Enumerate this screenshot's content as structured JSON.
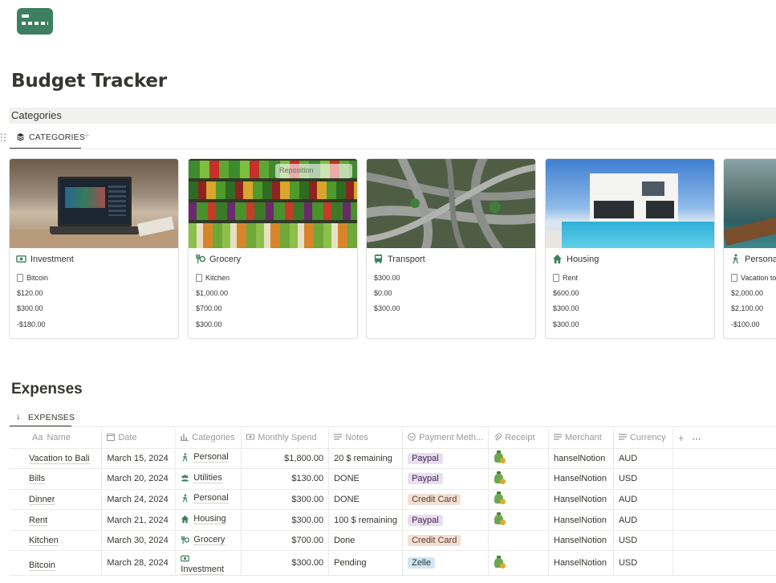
{
  "page": {
    "title": "Budget Tracker"
  },
  "categories": {
    "section_label": "Categories",
    "tab_label": "CATEGORIES",
    "cards": [
      {
        "name": "Investment",
        "cover": "laptop-stock-chart",
        "icon": "money-icon",
        "expense": "Bitcoin",
        "values": [
          "$120.00",
          "$300.00",
          "-$180.00"
        ]
      },
      {
        "name": "Grocery",
        "cover": "vegetable-market",
        "icon": "utensils-icon",
        "expense": "Kitchen",
        "values": [
          "$1,000.00",
          "$700.00",
          "$300.00"
        ],
        "overlay": "Reposition"
      },
      {
        "name": "Transport",
        "cover": "highway-interchange",
        "icon": "bus-icon",
        "expense": "",
        "values": [
          "$300.00",
          "$0.00",
          "$300.00"
        ]
      },
      {
        "name": "Housing",
        "cover": "modern-house-pool",
        "icon": "home-icon",
        "expense": "Rent",
        "values": [
          "$600.00",
          "$300.00",
          "$300.00"
        ]
      },
      {
        "name": "Personal",
        "cover": "lake-boat",
        "icon": "walking-icon",
        "expense": "Vacation to",
        "values": [
          "$2,000.00",
          "$2,100.00",
          "-$100.00"
        ]
      }
    ]
  },
  "expenses": {
    "section_label": "Expenses",
    "tab_label": "EXPENSES",
    "columns": [
      "Name",
      "Date",
      "Categories",
      "Monthly Spend",
      "Notes",
      "Payment Meth...",
      "Receipt",
      "Merchant",
      "Currency"
    ],
    "name_prefix": "Aa",
    "rows": [
      {
        "name": "Vacation to Bali",
        "date": "March 15, 2024",
        "category": "Personal",
        "cat_icon": "walking-icon",
        "spend": "$1,800.00",
        "notes": "20 $ remaining",
        "payment": "Paypal",
        "receipt": true,
        "merchant": "hanselNotion",
        "currency": "AUD"
      },
      {
        "name": "Bills",
        "date": "March 20, 2024",
        "category": "Utilities",
        "cat_icon": "people-icon",
        "spend": "$130.00",
        "notes": "DONE",
        "payment": "Paypal",
        "receipt": true,
        "merchant": "HanselNotion",
        "currency": "USD"
      },
      {
        "name": "Dinner",
        "date": "March 24, 2024",
        "category": "Personal",
        "cat_icon": "walking-icon",
        "spend": "$300.00",
        "notes": "DONE",
        "payment": "Credit Card",
        "receipt": true,
        "merchant": "HanselNotion",
        "currency": "AUD"
      },
      {
        "name": "Rent",
        "date": "March 21, 2024",
        "category": "Housing",
        "cat_icon": "home-icon",
        "spend": "$300.00",
        "notes": "100 $ remaining",
        "payment": "Paypal",
        "receipt": true,
        "merchant": "HanselNotion",
        "currency": "AUD"
      },
      {
        "name": "Kitchen",
        "date": "March 30, 2024",
        "category": "Grocery",
        "cat_icon": "utensils-icon",
        "spend": "$700.00",
        "notes": "Done",
        "payment": "Credit Card",
        "receipt": false,
        "merchant": "HanselNotion",
        "currency": "USD"
      },
      {
        "name": "Bitcoin",
        "date": "March 28, 2024",
        "category": "Investment",
        "cat_icon": "money-icon",
        "spend": "$300.00",
        "notes": "Pending",
        "payment": "Zelle",
        "receipt": true,
        "merchant": "HanselNotion",
        "currency": "USD"
      }
    ]
  },
  "colors": {
    "accent_green": "#3d7f5e",
    "tag_paypal": "#e8deee",
    "tag_credit_card": "#f4dfd5",
    "tag_zelle": "#d3e5ef"
  }
}
